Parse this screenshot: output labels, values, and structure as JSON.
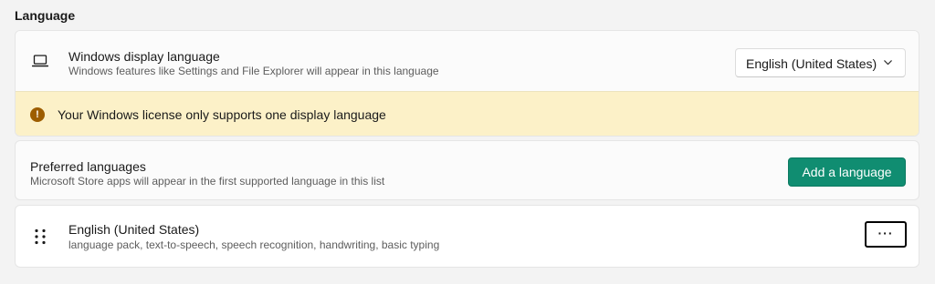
{
  "section": {
    "title": "Language"
  },
  "display_language": {
    "icon": "laptop-icon",
    "title": "Windows display language",
    "description": "Windows features like Settings and File Explorer will appear in this language",
    "selected_value": "English (United States)"
  },
  "warning": {
    "icon": "warning-icon",
    "glyph": "!",
    "text": "Your Windows license only supports one display language",
    "background_color": "#fcf1c8"
  },
  "preferred": {
    "title": "Preferred languages",
    "description": "Microsoft Store apps will appear in the first supported language in this list",
    "add_button_label": "Add a language",
    "accent_color": "#108d71"
  },
  "languages": [
    {
      "name": "English (United States)",
      "features": "language pack, text-to-speech, speech recognition, handwriting, basic typing",
      "more_label": "···"
    }
  ]
}
